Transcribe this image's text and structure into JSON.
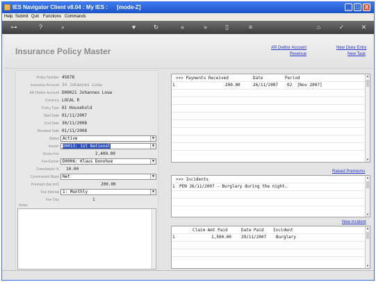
{
  "window": {
    "title": "IES Navigator Client v8.04 : My IES :      [mode-Z]",
    "minimize": "_",
    "maximize": "□",
    "close": "X"
  },
  "menu": [
    "Help",
    "Submit",
    "Quit",
    "Functions",
    "Commands"
  ],
  "toolbar_icons": [
    "key-icon",
    "help-icon",
    "search-icon",
    "heart-icon",
    "refresh-icon",
    "back-icon",
    "forward-icon",
    "document-icon",
    "list-icon",
    "home-icon",
    "check-icon",
    "close-icon"
  ],
  "page": {
    "title": "Insurance Policy Master",
    "links": {
      "ar_debtor_account": "AR Debtor Account",
      "revenue": "Revenue",
      "new_diary_entry": "New Diary Entry",
      "new_task": "New Task",
      "raised_premiums": "Raised Premiums",
      "new_incident": "New Incident"
    }
  },
  "form": {
    "policy_number": {
      "label": "Policy Number",
      "value": "45678"
    },
    "insurance_account": {
      "label": "Insurance Account",
      "value": "34 Johannes Louw"
    },
    "ar_debtor_account": {
      "label": "AR Debtor Account",
      "value": "D00021 Johannes Louw"
    },
    "currency": {
      "label": "Currency",
      "value": "LOCAL R"
    },
    "policy_type": {
      "label": "Policy Type",
      "value": "01 Household"
    },
    "start_date": {
      "label": "Start Date",
      "value": "01/11/2007"
    },
    "end_date": {
      "label": "End Date",
      "value": "30/11/2008"
    },
    "renewal_date": {
      "label": "Renewal Date",
      "value": "01/11/2008"
    },
    "status": {
      "label": "Status",
      "value": "Active"
    },
    "insurer": {
      "label": "Insurer",
      "value": "D0013: 1st National"
    },
    "gross_fee": {
      "label": "Gross Fee",
      "value": "2,400.00"
    },
    "fee_earner": {
      "label": "Fee Earner",
      "value": "D0006: Klaus Donohoe"
    },
    "commission_pct": {
      "label": "Commission %",
      "value": "10.00"
    },
    "commission_basis": {
      "label": "Commission Basis",
      "value": "Net"
    },
    "premium": {
      "label": "Premium (tax incl)",
      "value": "200.00"
    },
    "fee_interval": {
      "label": "Fee Interval",
      "value": "1: Monthly"
    },
    "fee_day": {
      "label": "Fee Day",
      "value": "1"
    },
    "notes": {
      "label": "Notes",
      "value": ""
    }
  },
  "payments": {
    "header": ">>> Payments Received",
    "col_date": "Date",
    "col_period": "Period",
    "rows": [
      {
        "num": "1",
        "amount": "200.00",
        "date": "26/11/2007",
        "period": "02  [Nov 2007]"
      }
    ]
  },
  "incidents": {
    "header": ">>> Incidents",
    "rows": [
      {
        "num": "1",
        "text": "PEN 26/11/2007 - Burglary during the night."
      }
    ]
  },
  "claims": {
    "col_amount": "Claim Amt Paid",
    "col_date": "Date Paid",
    "col_incident": "Incident",
    "rows": [
      {
        "num": "1",
        "amount": "1,500.00",
        "date": "29/11/2007",
        "incident": "Burglary"
      }
    ]
  }
}
